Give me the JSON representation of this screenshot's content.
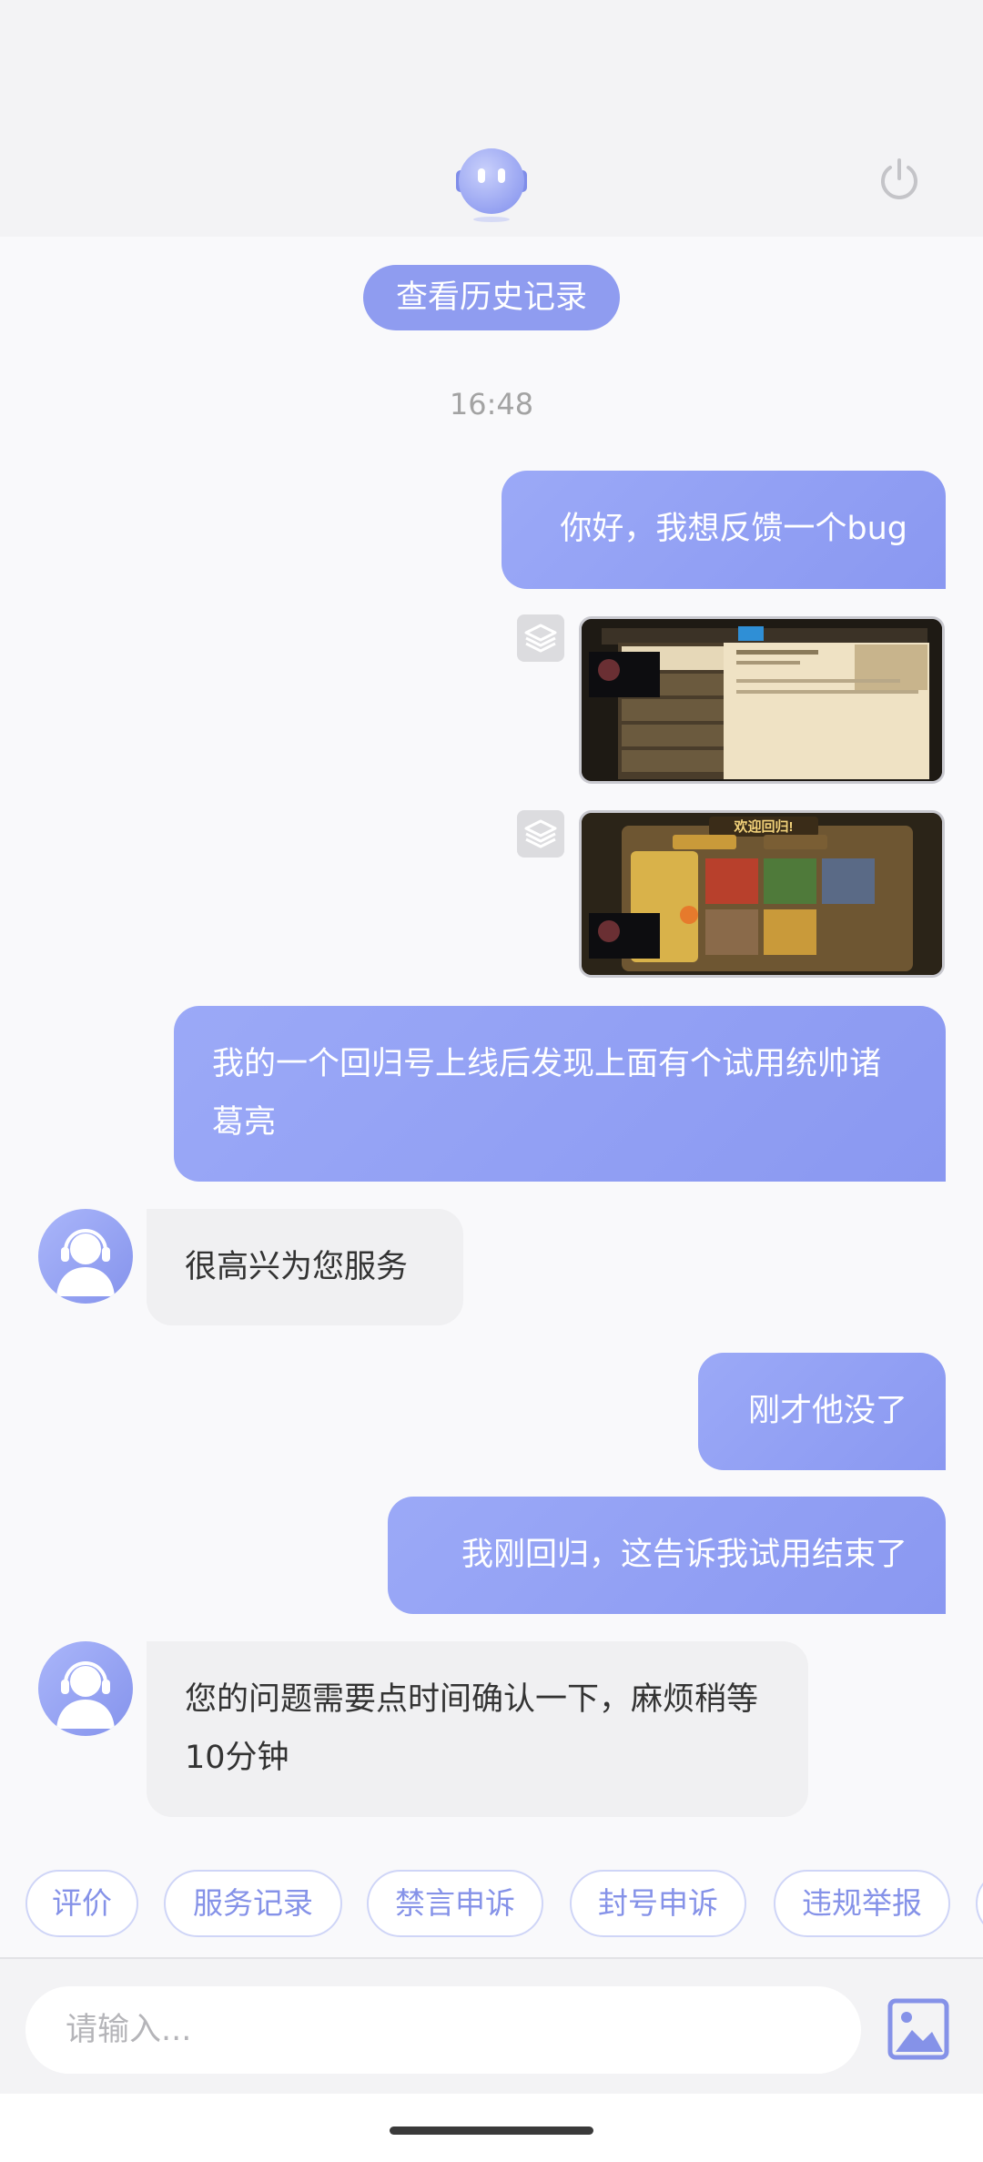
{
  "header": {
    "bot_avatar_icon": "robot-face-icon",
    "power_icon": "power-icon"
  },
  "history_button": "查看历史记录",
  "timestamp": "16:48",
  "messages": [
    {
      "from": "user",
      "type": "text",
      "text": "你好，我想反馈一个bug"
    },
    {
      "from": "user",
      "type": "image",
      "badge_icon": "layers-icon",
      "image": "game-screenshot-mail"
    },
    {
      "from": "user",
      "type": "image",
      "badge_icon": "layers-icon",
      "image": "game-screenshot-welcome-back",
      "image_title": "欢迎回归!"
    },
    {
      "from": "user",
      "type": "text",
      "text": "我的一个回归号上线后发现上面有个试用统帅诸葛亮"
    },
    {
      "from": "agent",
      "type": "text",
      "text": "很高兴为您服务"
    },
    {
      "from": "user",
      "type": "text",
      "text": "刚才他没了"
    },
    {
      "from": "user",
      "type": "text",
      "text": "我刚回归，这告诉我试用结束了"
    },
    {
      "from": "agent",
      "type": "text",
      "text": "您的问题需要点时间确认一下，麻烦稍等10分钟"
    }
  ],
  "quick_actions": [
    "评价",
    "服务记录",
    "禁言申诉",
    "封号申诉",
    "违规举报"
  ],
  "input": {
    "placeholder": "请输入...",
    "value": "",
    "image_button_icon": "image-upload-icon"
  },
  "colors": {
    "accent": "#8f9cf0",
    "user_bubble": "#929ff3",
    "agent_bubble": "#f0f0f2",
    "chip_text": "#8592e8",
    "background": "#f9f9fb"
  }
}
